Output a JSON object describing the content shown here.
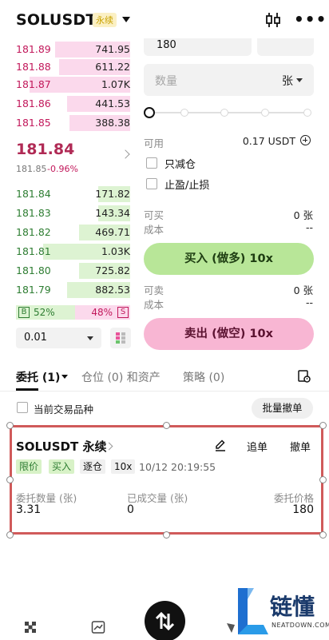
{
  "header": {
    "title": "SOLUSDT",
    "badge": "永续"
  },
  "asks": [
    {
      "price": "181.89",
      "qty": "741.95",
      "depth": 0.66
    },
    {
      "price": "181.88",
      "qty": "611.22",
      "depth": 0.62
    },
    {
      "price": "181.87",
      "qty": "1.07K",
      "depth": 0.88
    },
    {
      "price": "181.86",
      "qty": "441.53",
      "depth": 0.55
    },
    {
      "price": "181.85",
      "qty": "388.38",
      "depth": 0.53
    }
  ],
  "ticker": {
    "last": "181.84",
    "mark": "181.85",
    "change": "-0.96%"
  },
  "bids": [
    {
      "price": "181.84",
      "qty": "171.82",
      "depth": 0.28
    },
    {
      "price": "181.83",
      "qty": "143.34",
      "depth": 0.28
    },
    {
      "price": "181.82",
      "qty": "469.71",
      "depth": 0.45
    },
    {
      "price": "181.81",
      "qty": "1.03K",
      "depth": 0.76
    },
    {
      "price": "181.80",
      "qty": "725.82",
      "depth": 0.45
    },
    {
      "price": "181.79",
      "qty": "882.53",
      "depth": 0.55
    }
  ],
  "ratio": {
    "buy_label": "B",
    "buy_pct": "52%",
    "sell_label": "S",
    "sell_pct": "48%"
  },
  "precision": "0.01",
  "form": {
    "price_value": "180",
    "qty_placeholder": "数量",
    "qty_unit": "张",
    "available_label": "可用",
    "available_value": "0.17 USDT",
    "reduce_only": "只减仓",
    "tp_sl": "止盈/止损",
    "can_buy_label": "可买",
    "can_buy_value": "0 张",
    "cost_label": "成本",
    "cost_value": "--",
    "buy_button": "买入 (做多) 10x",
    "can_sell_label": "可卖",
    "can_sell_value": "0 张",
    "cost_label_2": "成本",
    "cost_value_2": "--",
    "sell_button": "卖出 (做空) 10x"
  },
  "tabs": {
    "orders": "委托 (1)",
    "positions": "仓位 (0) 和资产",
    "strategies": "策略 (0)"
  },
  "filter": {
    "current_symbol": "当前交易品种",
    "batch_cancel": "批量撤单"
  },
  "order": {
    "symbol": "SOLUSDT 永续",
    "chase": "追单",
    "cancel": "撤单",
    "tag_type": "限价",
    "tag_side": "买入",
    "tag_margin": "逐仓",
    "tag_leverage": "10x",
    "time": "10/12 20:19:55",
    "qty_label": "委托数量 (张)",
    "qty_value": "3.31",
    "filled_label": "已成交量 (张)",
    "filled_value": "0",
    "price_label": "委托价格",
    "price_value": "180"
  },
  "watermark": {
    "brand": "链懂",
    "site": "NEATDOWN.COM"
  },
  "colors": {
    "ask": "#c2185b",
    "bid": "#2e7d32",
    "buy_button": "#b8e698",
    "sell_button": "#f8b6d3",
    "highlight": "#d05a5a"
  }
}
